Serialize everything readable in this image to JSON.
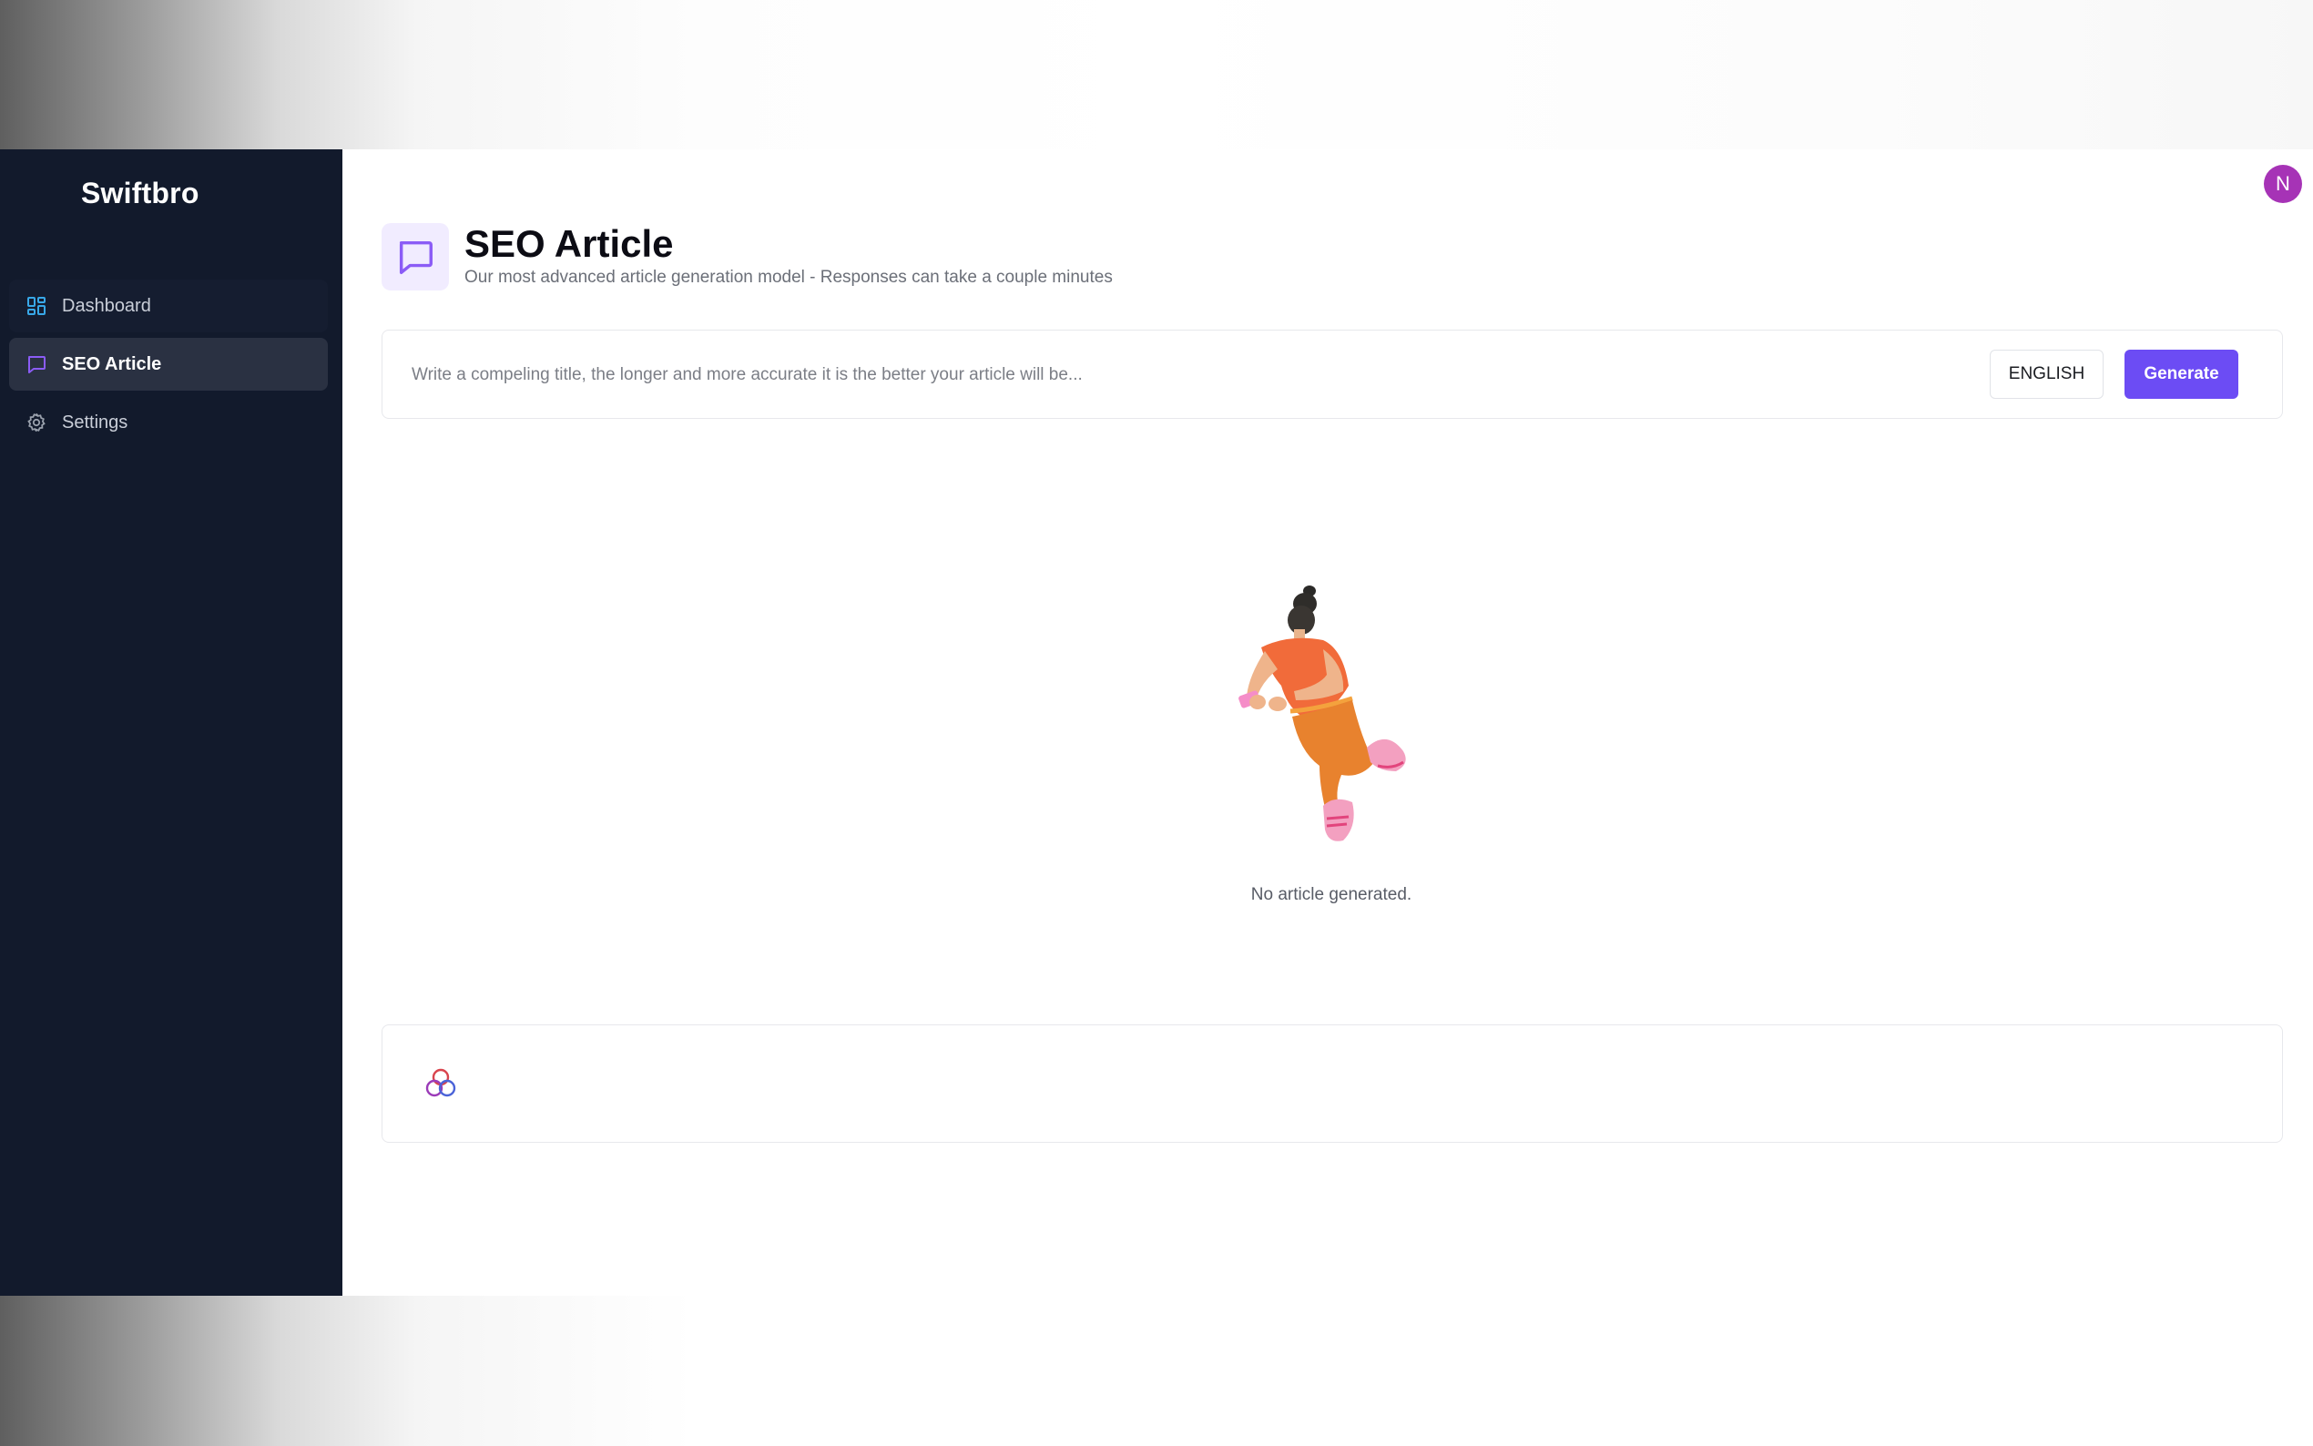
{
  "app": {
    "brand": "Swiftbro",
    "user_initial": "N",
    "colors": {
      "sidebar_bg": "#121a2c",
      "accent": "#6c4cf4",
      "avatar": "#a633b6"
    }
  },
  "sidebar": {
    "items": [
      {
        "label": "Dashboard",
        "icon": "dashboard-grid-icon",
        "active": false
      },
      {
        "label": "SEO Article",
        "icon": "chat-bubble-icon",
        "active": true
      },
      {
        "label": "Settings",
        "icon": "gear-icon",
        "active": false
      }
    ]
  },
  "header": {
    "icon": "chat-bubble-icon",
    "title": "SEO Article",
    "subtitle": "Our most advanced article generation model - Responses can take a couple minutes"
  },
  "composer": {
    "placeholder": "Write a compeling title, the longer and more accurate it is the better your article will be...",
    "value": "",
    "language": "ENGLISH",
    "generate_label": "Generate"
  },
  "empty_state": {
    "illustration": "person-with-phone-illustration",
    "text": "No article generated."
  },
  "footer_card": {
    "icon": "three-circles-logo-icon"
  }
}
